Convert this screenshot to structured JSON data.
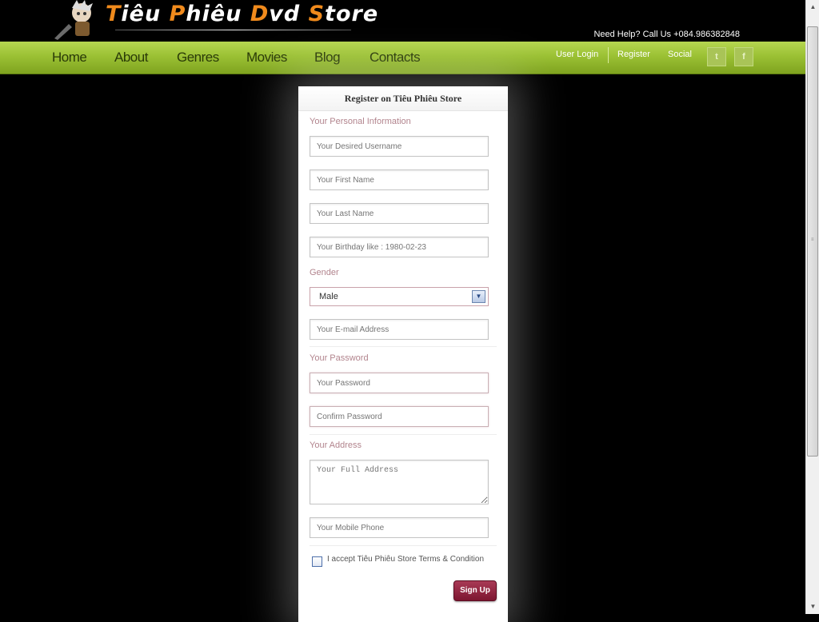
{
  "header": {
    "logo_text_parts": [
      "T",
      "iêu ",
      "P",
      "hiêu ",
      "D",
      "vd ",
      "S",
      "tore"
    ],
    "help_text": "Need Help? Call Us +084.986382848"
  },
  "nav": {
    "home": "Home",
    "about": "About",
    "genres": "Genres",
    "movies": "Movies",
    "blog": "Blog",
    "contacts": "Contacts",
    "user_login": "User Login",
    "register": "Register",
    "social": "Social",
    "twitter_icon": "twitter-icon",
    "facebook_icon": "facebook-icon",
    "twitter_glyph": "t",
    "facebook_glyph": "f"
  },
  "form": {
    "title": "Register on Tiêu Phiêu Store",
    "section_personal": "Your Personal Information",
    "username_placeholder": "Your Desired Username",
    "firstname_placeholder": "Your First Name",
    "lastname_placeholder": "Your Last Name",
    "birthday_placeholder": "Your Birthday like : 1980-02-23",
    "gender_label": "Gender",
    "gender_value": "Male",
    "email_placeholder": "Your E-mail Address",
    "section_password": "Your Password",
    "password_placeholder": "Your Password",
    "confirm_placeholder": "Confirm Password",
    "section_address": "Your Address",
    "address_placeholder": "Your Full Address",
    "phone_placeholder": "Your Mobile Phone",
    "terms_label": "I accept Tiêu Phiêu Store Terms & Condition",
    "signup_label": "Sign Up"
  },
  "colors": {
    "nav_green": "#9bc134",
    "section_label": "#b2848d",
    "signup_button": "#8e2540"
  }
}
